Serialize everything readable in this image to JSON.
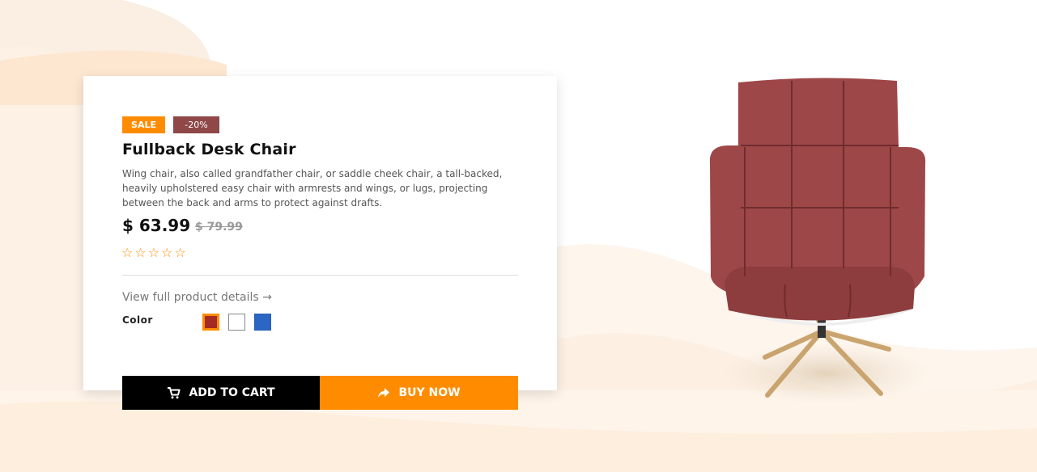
{
  "product": {
    "badges": {
      "sale": "SALE",
      "discount": "-20%"
    },
    "title": "Fullback Desk Chair",
    "description": "Wing chair, also called grandfather chair, or saddle cheek chair, a tall-backed, heavily upholstered easy chair with armrests and wings, or lugs, projecting between the back and arms to protect against drafts.",
    "price": "$ 63.99",
    "old_price": "$ 79.99",
    "rating": {
      "filled": 0,
      "max": 5,
      "glyphs": "☆☆☆☆☆"
    },
    "details_link": "View full product details →",
    "color_label": "Color",
    "colors": [
      "#a42a24",
      "#ffffff",
      "#2c66c4"
    ],
    "selected_color_index": 0
  },
  "actions": {
    "add_to_cart": "ADD TO CART",
    "buy_now": "BUY NOW"
  },
  "icons": {
    "cart": "cart-icon",
    "share": "share-arrow-icon"
  },
  "theme": {
    "accent": "#ff8c00",
    "discount": "#8f4747",
    "chair": "#9e4748",
    "wood": "#c9a46f"
  }
}
